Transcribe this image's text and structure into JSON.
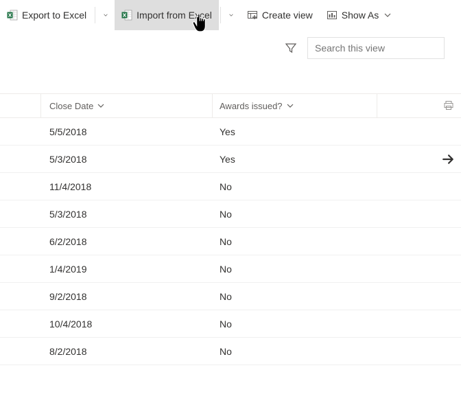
{
  "toolbar": {
    "export_label": "Export to Excel",
    "import_label": "Import from Excel",
    "create_view_label": "Create view",
    "show_as_label": "Show As"
  },
  "search": {
    "placeholder": "Search this view"
  },
  "columns": {
    "close_date": "Close Date",
    "awards_issued": "Awards issued?"
  },
  "rows": [
    {
      "date": "5/5/2018",
      "awards": "Yes",
      "arrow": false
    },
    {
      "date": "5/3/2018",
      "awards": "Yes",
      "arrow": true
    },
    {
      "date": "11/4/2018",
      "awards": "No",
      "arrow": false
    },
    {
      "date": "5/3/2018",
      "awards": "No",
      "arrow": false
    },
    {
      "date": "6/2/2018",
      "awards": "No",
      "arrow": false
    },
    {
      "date": "1/4/2019",
      "awards": "No",
      "arrow": false
    },
    {
      "date": "9/2/2018",
      "awards": "No",
      "arrow": false
    },
    {
      "date": "10/4/2018",
      "awards": "No",
      "arrow": false
    },
    {
      "date": "8/2/2018",
      "awards": "No",
      "arrow": false
    }
  ]
}
